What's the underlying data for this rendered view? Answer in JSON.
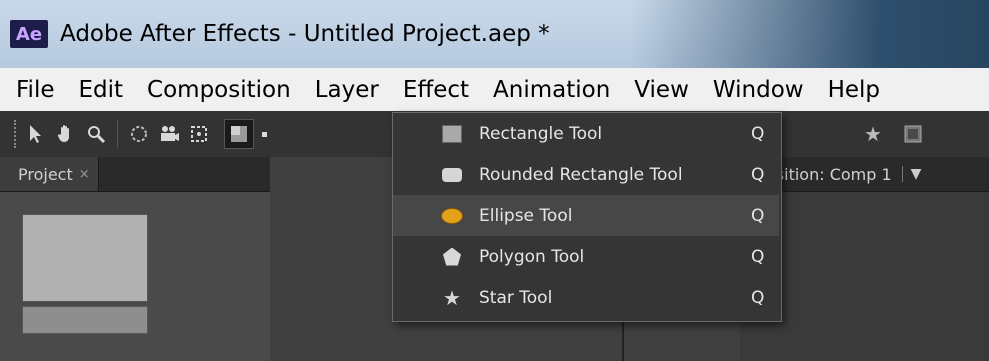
{
  "window": {
    "app_logo": "Ae",
    "title": "Adobe After Effects - Untitled Project.aep *"
  },
  "menubar": {
    "items": [
      "File",
      "Edit",
      "Composition",
      "Layer",
      "Effect",
      "Animation",
      "View",
      "Window",
      "Help"
    ]
  },
  "toolbar": {
    "tools": [
      "selection-tool-icon",
      "hand-tool-icon",
      "zoom-tool-icon",
      "rotation-tool-icon",
      "camera-tool-icon",
      "pan-behind-tool-icon",
      "shape-tool-icon"
    ],
    "right_tools": [
      "star-icon",
      "mask-icon"
    ]
  },
  "project_panel": {
    "tab_label": "Project",
    "close_glyph": "×"
  },
  "composition_panel": {
    "tab_label": "osition: Comp 1",
    "menu_glyph": "▼"
  },
  "shape_flyout": {
    "items": [
      {
        "label": "Rectangle Tool",
        "shortcut": "Q",
        "icon": "rectangle-icon"
      },
      {
        "label": "Rounded Rectangle Tool",
        "shortcut": "Q",
        "icon": "rounded-rectangle-icon"
      },
      {
        "label": "Ellipse Tool",
        "shortcut": "Q",
        "icon": "ellipse-icon",
        "selected": true
      },
      {
        "label": "Polygon Tool",
        "shortcut": "Q",
        "icon": "polygon-icon"
      },
      {
        "label": "Star Tool",
        "shortcut": "Q",
        "icon": "star-icon"
      }
    ]
  }
}
